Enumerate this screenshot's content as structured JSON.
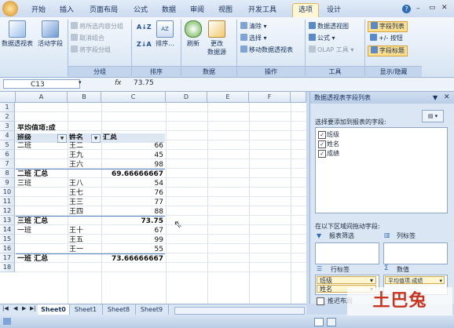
{
  "ribbon_tabs": [
    "开始",
    "插入",
    "页面布局",
    "公式",
    "数据",
    "审阅",
    "视图",
    "开发工具",
    "选项",
    "设计"
  ],
  "active_tab": "选项",
  "ribbon": {
    "pivot_table": "数据透视表",
    "active_field": "活动字段",
    "group_sel": "将所选内容分组",
    "ungroup": "取消组合",
    "group_field": "将字段分组",
    "group_label": "分组",
    "sort": "排序...",
    "sort_group_label": "排序",
    "refresh": "刷新",
    "change_source_1": "更改",
    "change_source_2": "数据源",
    "data_label": "数据",
    "clear": "清除",
    "select": "选择",
    "move": "移动数据透视表",
    "actions_label": "操作",
    "pivot_chart": "数据透视图",
    "formulas": "公式",
    "olap": "OLAP 工具",
    "tools_label": "工具",
    "field_list": "字段列表",
    "buttons": "+/- 按钮",
    "field_headers": "字段标题",
    "show_hide_label": "显示/隐藏"
  },
  "formula_bar": {
    "name_box": "C13",
    "fx": "fx",
    "value": "73.75"
  },
  "columns": [
    "A",
    "B",
    "C",
    "D",
    "E",
    "F"
  ],
  "rows": [
    "1",
    "2",
    "3",
    "4",
    "5",
    "6",
    "7",
    "8",
    "9",
    "10",
    "11",
    "12",
    "13",
    "14",
    "15",
    "16",
    "17",
    "18"
  ],
  "pivot": {
    "title": "平均值项:成",
    "hdr_class": "班级",
    "hdr_name": "姓名",
    "hdr_total": "汇总",
    "rows": [
      {
        "a": "二班",
        "b": "王二",
        "c": "66"
      },
      {
        "a": "",
        "b": "王九",
        "c": "45"
      },
      {
        "a": "",
        "b": "王六",
        "c": "98"
      },
      {
        "a": "二班 汇总",
        "b": "",
        "c": "69.66666667",
        "total": true
      },
      {
        "a": "三班",
        "b": "王八",
        "c": "54"
      },
      {
        "a": "",
        "b": "王七",
        "c": "76"
      },
      {
        "a": "",
        "b": "王三",
        "c": "77"
      },
      {
        "a": "",
        "b": "王四",
        "c": "88"
      },
      {
        "a": "三班 汇总",
        "b": "",
        "c": "73.75",
        "total": true
      },
      {
        "a": "一班",
        "b": "王十",
        "c": "67"
      },
      {
        "a": "",
        "b": "王五",
        "c": "99"
      },
      {
        "a": "",
        "b": "王一",
        "c": "55"
      },
      {
        "a": "一班 汇总",
        "b": "",
        "c": "73.66666667",
        "total": true
      }
    ]
  },
  "pane": {
    "title": "数据透视表字段列表",
    "choose_label": "选择要添加到报表的字段:",
    "fields": [
      "班级",
      "姓名",
      "成绩"
    ],
    "drag_label": "在以下区域间拖动字段:",
    "report_filter": "报表筛选",
    "col_labels": "列标签",
    "row_labels": "行标签",
    "values": "数值",
    "row_chips": [
      "班级",
      "姓名"
    ],
    "value_chip": "平均值项:成绩",
    "defer_label": "推迟布局"
  },
  "sheet_tabs": [
    "Sheet0",
    "Sheet1",
    "Sheet8",
    "Sheet9"
  ],
  "watermark": "土巴兔",
  "colors": {
    "accent": "#15315c",
    "ribbon": "#d7e4f3",
    "active_tab": "#fff7d8"
  }
}
